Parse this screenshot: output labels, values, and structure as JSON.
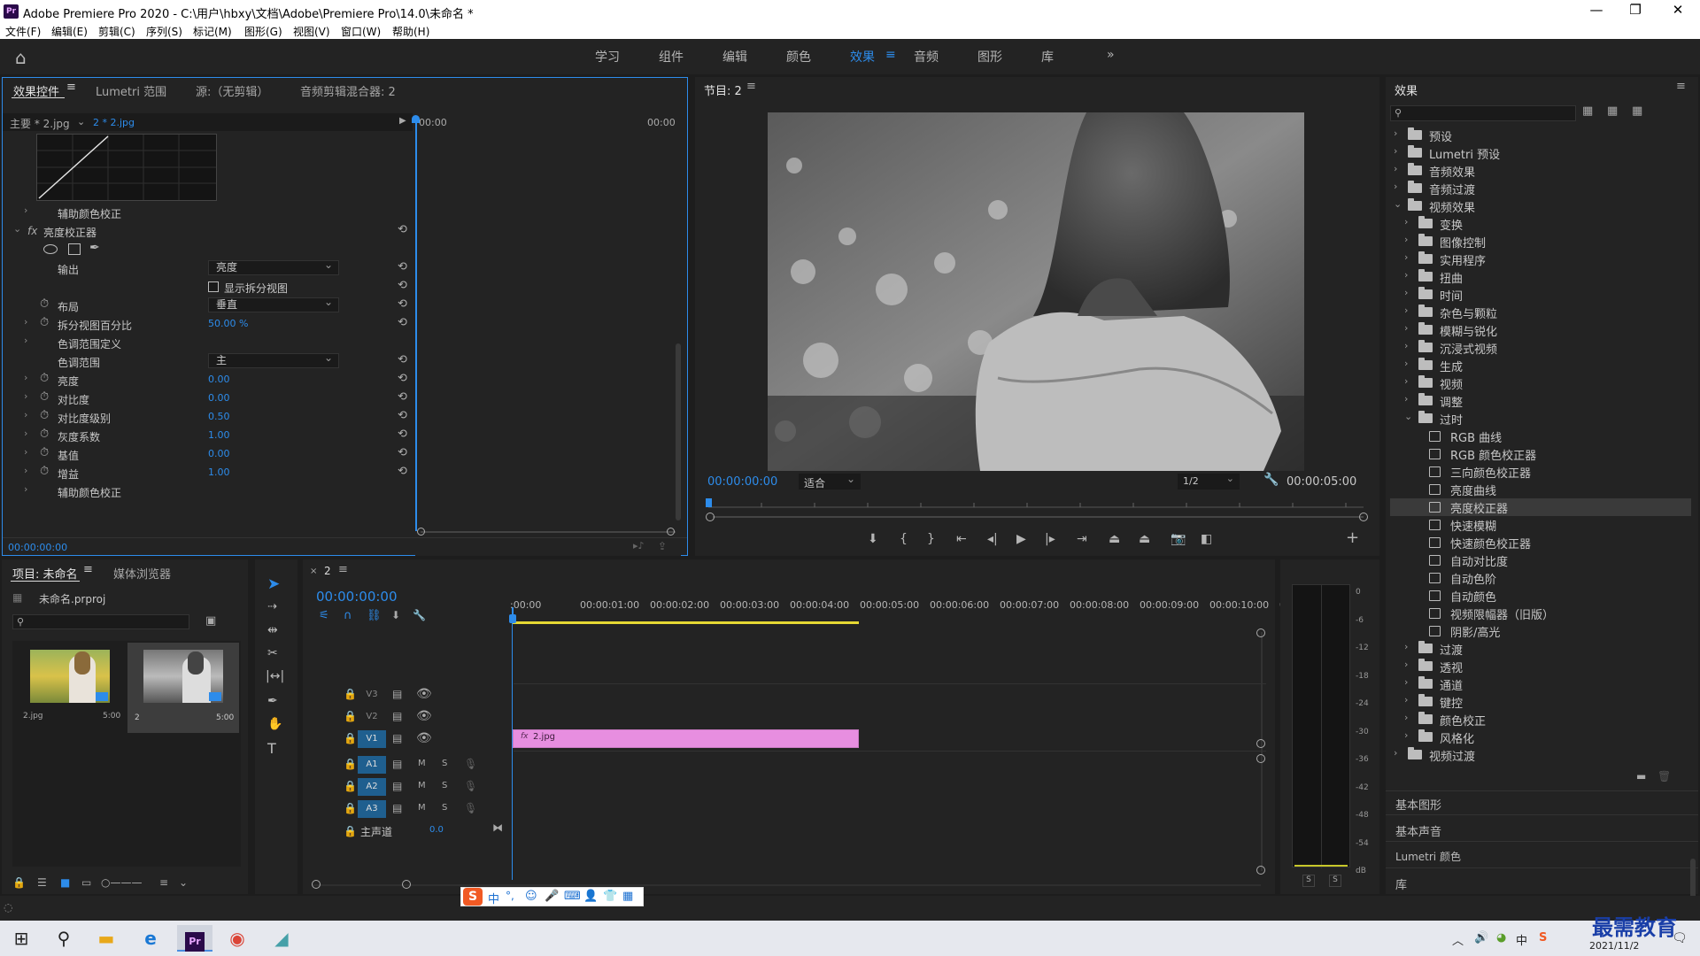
{
  "window": {
    "title": "Adobe Premiere Pro 2020 - C:\\用户\\hbxy\\文档\\Adobe\\Premiere Pro\\14.0\\未命名 *",
    "logo": "Pr"
  },
  "menu": [
    "文件(F)",
    "编辑(E)",
    "剪辑(C)",
    "序列(S)",
    "标记(M)",
    "图形(G)",
    "视图(V)",
    "窗口(W)",
    "帮助(H)"
  ],
  "workspaces": {
    "items": [
      "学习",
      "组件",
      "编辑",
      "颜色",
      "效果",
      "音频",
      "图形",
      "库"
    ],
    "active": "效果",
    "more": "»"
  },
  "effect_controls": {
    "tabs": [
      "效果控件",
      "Lumetri 范围",
      "源:（无剪辑）",
      "音频剪辑混合器: 2"
    ],
    "master": "主要 * 2.jpg",
    "clip": "2 * 2.jpg",
    "tc_start": "00:00",
    "tc_end": "00:00",
    "rows": {
      "aux1": "辅助颜色校正",
      "fx_name": "亮度校正器",
      "output_label": "输出",
      "output_value": "亮度",
      "split_view": "显示拆分视图",
      "layout_label": "布局",
      "layout_value": "垂直",
      "split_pct_label": "拆分视图百分比",
      "split_pct_value": "50.00 %",
      "tonal_def": "色调范围定义",
      "tonal_label": "色调范围",
      "tonal_value": "主",
      "brightness": "亮度",
      "brightness_v": "0.00",
      "contrast": "对比度",
      "contrast_v": "0.00",
      "contrast_level": "对比度级别",
      "contrast_level_v": "0.50",
      "gamma": "灰度系数",
      "gamma_v": "1.00",
      "pedestal": "基值",
      "pedestal_v": "0.00",
      "gain": "增益",
      "gain_v": "1.00",
      "aux2": "辅助颜色校正"
    },
    "footer_tc": "00:00:00:00"
  },
  "program": {
    "tab": "节目: 2",
    "tc": "00:00:00:00",
    "fit": "适合",
    "quality": "1/2",
    "duration": "00:00:05:00"
  },
  "effects_panel": {
    "title": "效果",
    "items": [
      {
        "label": "预设",
        "level": 0,
        "type": "folder"
      },
      {
        "label": "Lumetri 预设",
        "level": 0,
        "type": "folder"
      },
      {
        "label": "音频效果",
        "level": 0,
        "type": "folder"
      },
      {
        "label": "音频过渡",
        "level": 0,
        "type": "folder"
      },
      {
        "label": "视频效果",
        "level": 0,
        "type": "folder",
        "open": true
      },
      {
        "label": "变换",
        "level": 1,
        "type": "folder"
      },
      {
        "label": "图像控制",
        "level": 1,
        "type": "folder"
      },
      {
        "label": "实用程序",
        "level": 1,
        "type": "folder"
      },
      {
        "label": "扭曲",
        "level": 1,
        "type": "folder"
      },
      {
        "label": "时间",
        "level": 1,
        "type": "folder"
      },
      {
        "label": "杂色与颗粒",
        "level": 1,
        "type": "folder"
      },
      {
        "label": "模糊与锐化",
        "level": 1,
        "type": "folder"
      },
      {
        "label": "沉浸式视频",
        "level": 1,
        "type": "folder"
      },
      {
        "label": "生成",
        "level": 1,
        "type": "folder"
      },
      {
        "label": "视频",
        "level": 1,
        "type": "folder"
      },
      {
        "label": "调整",
        "level": 1,
        "type": "folder"
      },
      {
        "label": "过时",
        "level": 1,
        "type": "folder",
        "open": true
      },
      {
        "label": "RGB 曲线",
        "level": 2,
        "type": "fx"
      },
      {
        "label": "RGB 颜色校正器",
        "level": 2,
        "type": "fx"
      },
      {
        "label": "三向颜色校正器",
        "level": 2,
        "type": "fx"
      },
      {
        "label": "亮度曲线",
        "level": 2,
        "type": "fx"
      },
      {
        "label": "亮度校正器",
        "level": 2,
        "type": "fx",
        "selected": true
      },
      {
        "label": "快速模糊",
        "level": 2,
        "type": "fx"
      },
      {
        "label": "快速颜色校正器",
        "level": 2,
        "type": "fx"
      },
      {
        "label": "自动对比度",
        "level": 2,
        "type": "fx"
      },
      {
        "label": "自动色阶",
        "level": 2,
        "type": "fx"
      },
      {
        "label": "自动颜色",
        "level": 2,
        "type": "fx"
      },
      {
        "label": "视频限幅器（旧版）",
        "level": 2,
        "type": "fx"
      },
      {
        "label": "阴影/高光",
        "level": 2,
        "type": "fx"
      },
      {
        "label": "过渡",
        "level": 1,
        "type": "folder"
      },
      {
        "label": "透视",
        "level": 1,
        "type": "folder"
      },
      {
        "label": "通道",
        "level": 1,
        "type": "folder"
      },
      {
        "label": "键控",
        "level": 1,
        "type": "folder"
      },
      {
        "label": "颜色校正",
        "level": 1,
        "type": "folder"
      },
      {
        "label": "风格化",
        "level": 1,
        "type": "folder"
      },
      {
        "label": "视频过渡",
        "level": 0,
        "type": "folder"
      }
    ],
    "sections": [
      "基本图形",
      "基本声音",
      "Lumetri 颜色",
      "库"
    ]
  },
  "project": {
    "tabs": [
      "项目: 未命名",
      "媒体浏览器"
    ],
    "file": "未命名.prproj",
    "items": [
      {
        "name": "2.jpg",
        "dur": "5:00"
      },
      {
        "name": "2",
        "dur": "5:00"
      }
    ]
  },
  "timeline": {
    "tab": "2",
    "tc": "00:00:00:00",
    "ruler": [
      ":00:00",
      "00:00:01:00",
      "00:00:02:00",
      "00:00:03:00",
      "00:00:04:00",
      "00:00:05:00",
      "00:00:06:00",
      "00:00:07:00",
      "00:00:08:00",
      "00:00:09:00",
      "00:00:10:00",
      "0"
    ],
    "video_tracks": [
      "V3",
      "V2",
      "V1"
    ],
    "audio_tracks": [
      "A1",
      "A2",
      "A3"
    ],
    "master_label": "主声道",
    "master_value": "0.0",
    "clip_name": "2.jpg",
    "m": "M",
    "s": "S"
  },
  "vu": {
    "labels": [
      "0",
      "-6",
      "-12",
      "-18",
      "-24",
      "-30",
      "-36",
      "-42",
      "-48",
      "-54",
      "dB"
    ],
    "s_left": "S",
    "s_right": "S"
  },
  "ime": {
    "cn": "中",
    "punct": "°,"
  },
  "taskbar": {
    "date": "2021/11/2"
  },
  "watermark": "最需教育",
  "colors": {
    "accent": "#2d8ceb",
    "clip_pink": "#e78ee0",
    "panel": "#232323"
  }
}
